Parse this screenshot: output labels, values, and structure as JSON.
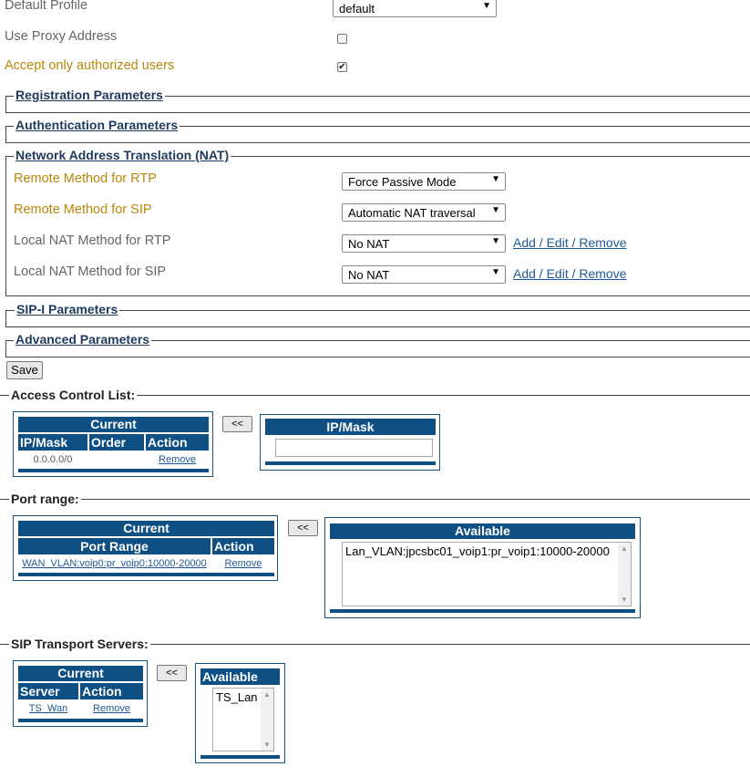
{
  "profile": {
    "default_profile_label": "Default Profile",
    "default_profile_value": "default",
    "use_proxy_label": "Use Proxy Address",
    "use_proxy_checked": false,
    "accept_auth_label": "Accept only authorized users",
    "accept_auth_checked": true
  },
  "sections": {
    "registration": "Registration Parameters",
    "authentication": "Authentication Parameters",
    "nat": "Network Address Translation (NAT)",
    "sipi": "SIP-I Parameters",
    "advanced": "Advanced Parameters"
  },
  "nat": {
    "rtp_remote_label": "Remote Method for RTP",
    "rtp_remote_value": "Force Passive Mode",
    "sip_remote_label": "Remote Method for SIP",
    "sip_remote_value": "Automatic NAT traversal",
    "rtp_local_label": "Local NAT Method for RTP",
    "rtp_local_value": "No NAT",
    "sip_local_label": "Local NAT Method for SIP",
    "sip_local_value": "No NAT",
    "edit_link": "Add / Edit / Remove"
  },
  "save_label": "Save",
  "move_label": "<<",
  "acl": {
    "title": "Access Control List:",
    "current_header": "Current",
    "columns": [
      "IP/Mask",
      "Order",
      "Action"
    ],
    "row": {
      "ip": "0.0.0.0/0",
      "order": "",
      "action": "Remove"
    },
    "available_header": "IP/Mask",
    "input_value": ""
  },
  "port_range": {
    "title": "Port range:",
    "current_header": "Current",
    "columns": [
      "Port Range",
      "Action"
    ],
    "row": {
      "range": "WAN_VLAN:voip0:pr_voip0:10000-20000",
      "action": "Remove"
    },
    "available_header": "Available",
    "available_items": [
      "Lan_VLAN:jpcsbc01_voip1:pr_voip1:10000-20000"
    ]
  },
  "sip_transport": {
    "title": "SIP Transport Servers:",
    "current_header": "Current",
    "columns": [
      "Server",
      "Action"
    ],
    "row": {
      "server": "TS_Wan",
      "action": "Remove"
    },
    "available_header": "Available",
    "available_items": [
      "TS_Lan"
    ]
  },
  "colors": {
    "header_blue": "#0e4f84",
    "warn_label": "#b8860b",
    "link": "#1f5a96"
  }
}
